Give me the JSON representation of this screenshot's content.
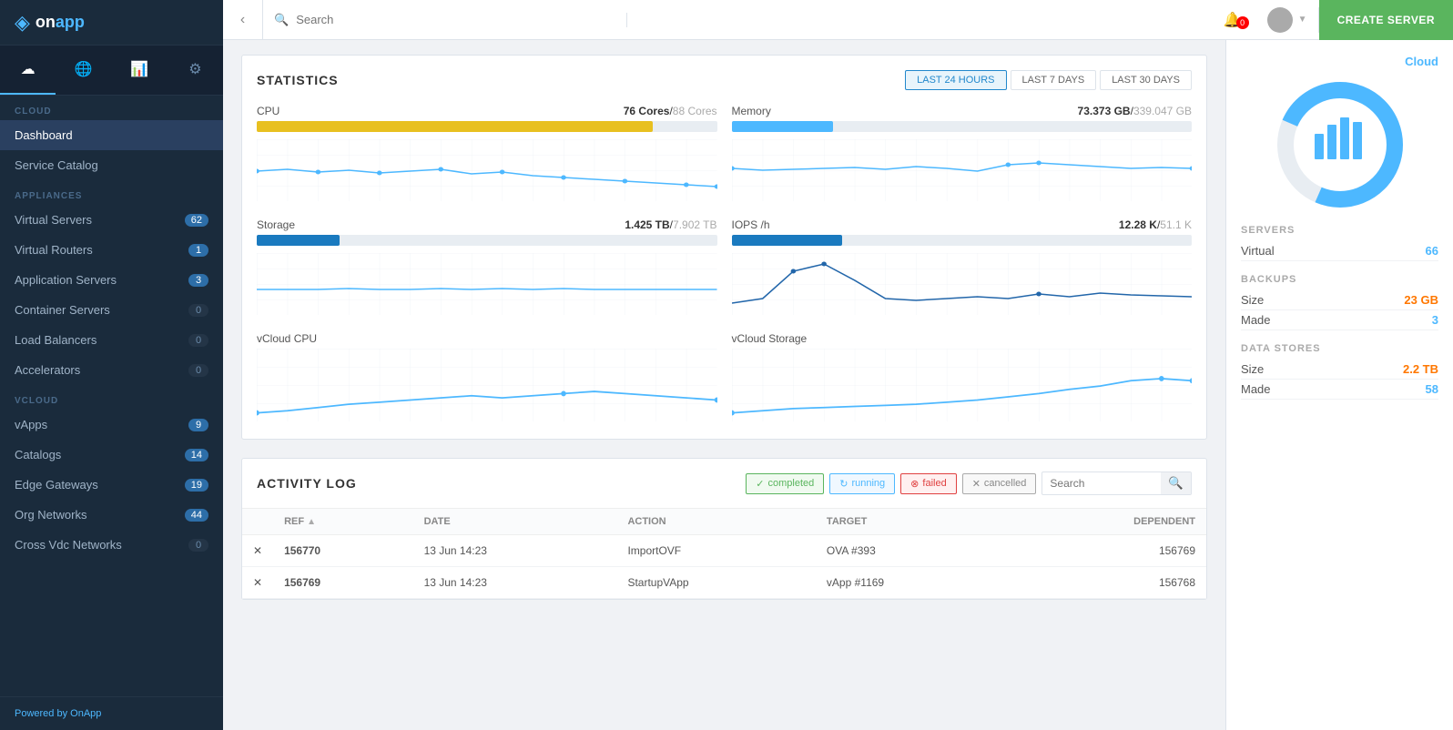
{
  "sidebar": {
    "logo": "on app",
    "logo_icon": "◈",
    "sections": [
      {
        "label": "CLOUD",
        "items": [
          {
            "name": "Dashboard",
            "badge": null,
            "active": true
          },
          {
            "name": "Service Catalog",
            "badge": null
          }
        ]
      },
      {
        "label": "APPLIANCES",
        "items": [
          {
            "name": "Virtual Servers",
            "badge": "62"
          },
          {
            "name": "Virtual Routers",
            "badge": "1"
          },
          {
            "name": "Application Servers",
            "badge": "3"
          },
          {
            "name": "Container Servers",
            "badge": "0",
            "zero": true
          },
          {
            "name": "Load Balancers",
            "badge": "0",
            "zero": true
          },
          {
            "name": "Accelerators",
            "badge": "0",
            "zero": true
          }
        ]
      },
      {
        "label": "VCLOUD",
        "items": [
          {
            "name": "vApps",
            "badge": "9"
          },
          {
            "name": "Catalogs",
            "badge": "14"
          },
          {
            "name": "Edge Gateways",
            "badge": "19"
          },
          {
            "name": "Org Networks",
            "badge": "44"
          },
          {
            "name": "Cross Vdc Networks",
            "badge": "0",
            "zero": true
          }
        ]
      }
    ],
    "footer_text": "Powered by ",
    "footer_brand": "OnApp"
  },
  "topbar": {
    "search_placeholder": "Search",
    "notification_count": "0",
    "create_button": "CREATE SERVER"
  },
  "statistics": {
    "title": "STATISTICS",
    "time_buttons": [
      "LAST 24 HOURS",
      "LAST 7 DAYS",
      "LAST 30 DAYS"
    ],
    "active_time": "LAST 24 HOURS",
    "metrics": [
      {
        "name": "CPU",
        "current": "76 Cores",
        "total": "88 Cores",
        "fill_pct": 86,
        "color": "yellow"
      },
      {
        "name": "Memory",
        "current": "73.373 GB",
        "total": "339.047 GB",
        "fill_pct": 22,
        "color": "blue"
      },
      {
        "name": "Storage",
        "current": "1.425 TB",
        "total": "7.902 TB",
        "fill_pct": 18,
        "color": "darkblue"
      },
      {
        "name": "IOPS /h",
        "current": "12.28 K",
        "total": "51.1 K",
        "fill_pct": 24,
        "color": "darkblue"
      },
      {
        "name": "vCloud CPU",
        "current": "",
        "total": "",
        "fill_pct": 0,
        "color": "blue"
      },
      {
        "name": "vCloud Storage",
        "current": "",
        "total": "",
        "fill_pct": 0,
        "color": "blue"
      }
    ]
  },
  "right_panel": {
    "cloud_label": "Cloud",
    "servers_title": "SERVERS",
    "servers": [
      {
        "label": "Virtual",
        "value": "66"
      }
    ],
    "backups_title": "BACKUPS",
    "backups": [
      {
        "label": "Size",
        "value": "23 GB"
      },
      {
        "label": "Made",
        "value": "3"
      }
    ],
    "datastores_title": "DATA STORES",
    "datastores": [
      {
        "label": "Size",
        "value": "2.2 TB"
      },
      {
        "label": "Made",
        "value": "58"
      }
    ]
  },
  "activity_log": {
    "title": "ACTIVITY LOG",
    "filters": {
      "completed": "completed",
      "running": "running",
      "failed": "failed",
      "cancelled": "cancelled"
    },
    "search_placeholder": "Search",
    "columns": [
      "Ref",
      "Date",
      "Action",
      "Target",
      "Dependent"
    ],
    "rows": [
      {
        "ref": "156770",
        "date": "13 Jun 14:23",
        "action": "ImportOVF",
        "target": "OVA #393",
        "dependent": "156769"
      },
      {
        "ref": "156769",
        "date": "13 Jun 14:23",
        "action": "StartupVApp",
        "target": "vApp #1169",
        "dependent": "156768"
      }
    ]
  }
}
